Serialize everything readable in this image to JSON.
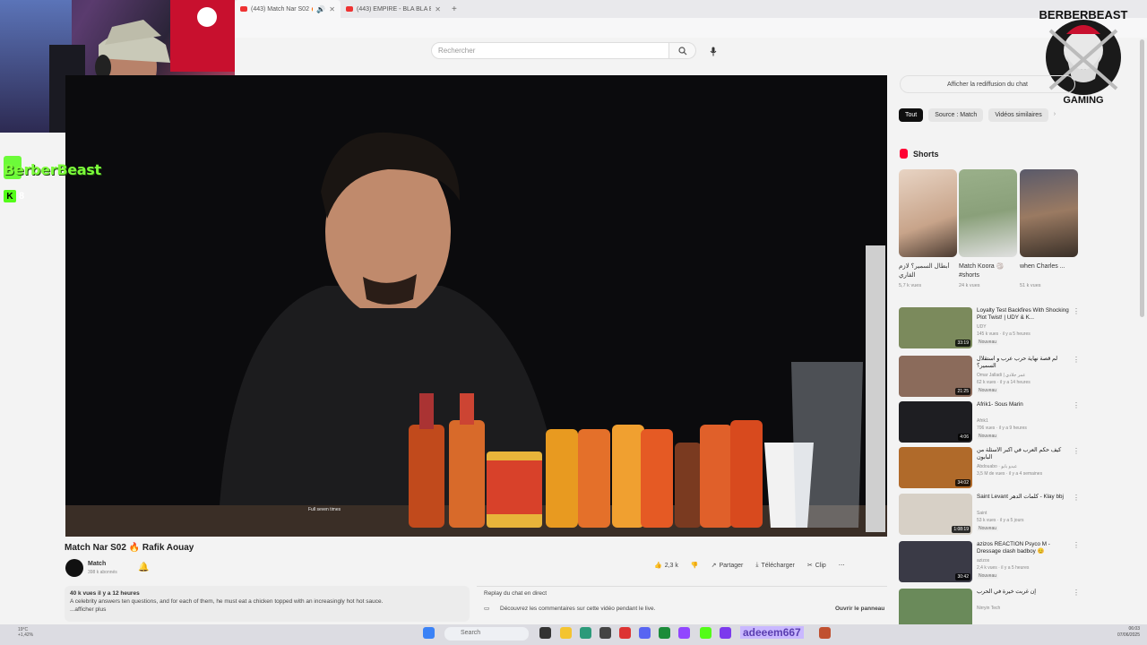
{
  "browser": {
    "tabs": [
      {
        "title": "(443) Match Nar S02 🔥 R"
      },
      {
        "title": "(443) EMPIRE - BLA BLA BLA -"
      }
    ],
    "new_tab": "+"
  },
  "header": {
    "search_placeholder": "Rechercher"
  },
  "overlay": {
    "brand_text": "BerberBeast",
    "kick_viewers": "8",
    "kick_letter": "K",
    "logo_top": "BERBERBEAST",
    "logo_bottom": "GAMING"
  },
  "video": {
    "caption": "Full seven times",
    "title": "Match Nar S02 🔥 Rafik Aouay",
    "channel": "Match",
    "subscribers": "398 k abonnés",
    "likes": "2,3 k",
    "share_label": "Partager",
    "download_label": "Télécharger",
    "clip_label": "Clip",
    "more": "⋯",
    "description": {
      "meta": "40 k vues  il y a 12 heures",
      "text": "A celebrity answers ten questions, and for each of them, he must eat a chicken topped with an increasingly hot hot sauce.",
      "more": "...afficher plus"
    },
    "chat_replay": {
      "title": "Replay du chat en direct",
      "text": "Découvrez les commentaires sur cette vidéo pendant le live.",
      "button": "Ouvrir le panneau"
    }
  },
  "sidebar": {
    "show_chat": "Afficher la rediffusion du chat",
    "chips": [
      "Tout",
      "Source : Match",
      "Vidéos similaires"
    ],
    "shorts_label": "Shorts",
    "shorts": [
      {
        "title": "أبطال السمير؟ لازم القاري",
        "views": "5,7 k vues",
        "thumb": "#c8a48a"
      },
      {
        "title": "Match Koora 🏐 #shorts",
        "views": "24 k vues",
        "thumb": "#8aa07a"
      },
      {
        "title": "when Charles ...",
        "views": "51 k vues",
        "thumb": "#7a6a5a"
      }
    ],
    "recommendations": [
      {
        "title": "Loyalty Test Backfires With Shocking Plot Twist! | UDY & K...",
        "channel": "UDY",
        "views": "145 k vues · il y a 5 heures",
        "badge": "Nouveau",
        "duration": "33:19",
        "thumb": "#7b8a5c"
      },
      {
        "title": "لم قصة نهاية حرب عرب و استقلال السمير؟",
        "channel": "Omar Jalladi | عمر جلادي",
        "views": "62 k vues · il y a 14 heures",
        "badge": "Nouveau",
        "duration": "21:25",
        "thumb": "#8b6b5b"
      },
      {
        "title": "Afrik1- Sous Marin",
        "channel": "Afrik1",
        "views": "706 vues · il y a 9 heures",
        "badge": "Nouveau",
        "duration": "4:06",
        "thumb": "#1e1e22"
      },
      {
        "title": "كيف حكم العرب في أكبر الأسئلة من البابون",
        "channel": "Abdouabo · عبدو بابو",
        "views": "3,5 M de vues · il y a 4 semaines",
        "badge": "",
        "duration": "34:02",
        "thumb": "#b06a2a"
      },
      {
        "title": "Saint Levant كلمات الدهر - Klay bbj",
        "channel": "Saint",
        "views": "53 k vues · il y a 5 jours",
        "badge": "Nouveau",
        "duration": "1:08:19",
        "thumb": "#d7d0c6"
      },
      {
        "title": "azizos REACTION Psyco M - Dressage clash badboy 😊",
        "channel": "azizos",
        "views": "2,4 k vues · il y a 5 heures",
        "badge": "Nouveau",
        "duration": "30:42",
        "thumb": "#3a3a46"
      },
      {
        "title": "إن غربت خيرة في الحرب",
        "channel": "Nirryin Tech",
        "views": "",
        "badge": "",
        "duration": "",
        "thumb": "#6a8a5a"
      }
    ]
  },
  "taskbar": {
    "weather_temp": "19°C",
    "weather_text": "+1,42%",
    "search": "Search",
    "kick_username": "adeeem667",
    "time": "06:03",
    "date": "07/06/2025"
  }
}
